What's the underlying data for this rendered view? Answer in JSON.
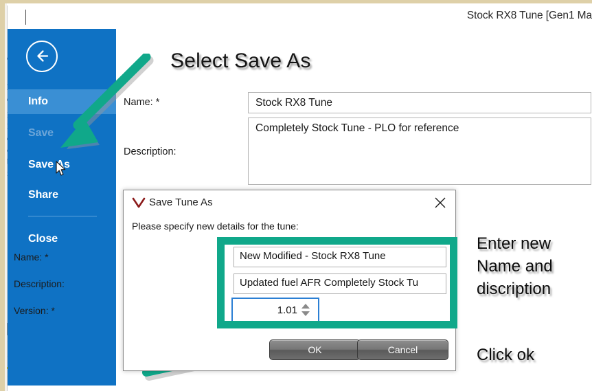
{
  "window": {
    "title": "Stock RX8 Tune [Gen1 Ma"
  },
  "colors": {
    "sidebar_blue": "#0f72c4",
    "sidebar_active_blue": "#3a8fd4",
    "annotation_green": "#10a88a",
    "accent_focus_blue": "#2b7fd4",
    "dialog_logo_red": "#8b1a1a"
  },
  "sidebar": {
    "back_icon": "back-arrow-icon",
    "items": [
      {
        "label": "Info",
        "state": "active"
      },
      {
        "label": "Save",
        "state": "disabled"
      },
      {
        "label": "Save As",
        "state": "normal"
      },
      {
        "label": "Share",
        "state": "normal"
      },
      {
        "label": "Close",
        "state": "normal"
      }
    ]
  },
  "ghost_text": [
    "o",
    "R",
    "e",
    "I",
    "l",
    "e",
    "o",
    "b",
    "i",
    "f",
    "."
  ],
  "backstage": {
    "heading_annotation": "Select Save As",
    "name_label": "Name: *",
    "name_value": "Stock RX8 Tune",
    "description_label": "Description:",
    "description_value": "Completely Stock Tune - PLO for reference"
  },
  "dialog": {
    "icon": "v-logo-icon",
    "title": "Save Tune As",
    "close_icon": "close-icon",
    "instruction": "Please specify new details for the tune:",
    "fields": [
      {
        "label": "Name: *",
        "value": "New Modified - Stock RX8 Tune"
      },
      {
        "label": "Description:",
        "value": "Updated fuel AFR Completely Stock Tu"
      },
      {
        "label": "Version: *",
        "value": "1.01"
      }
    ],
    "spinner_up_icon": "spinner-up-icon",
    "spinner_down_icon": "spinner-down-icon",
    "ok_label": "OK",
    "cancel_label": "Cancel"
  },
  "annotations": {
    "enter_details_line1": "Enter new",
    "enter_details_line2": "Name and",
    "enter_details_line3": "discription",
    "click_ok": "Click ok",
    "arrow_to_save_as": "green-arrow-icon",
    "arrow_to_ok": "green-arrow-icon"
  }
}
